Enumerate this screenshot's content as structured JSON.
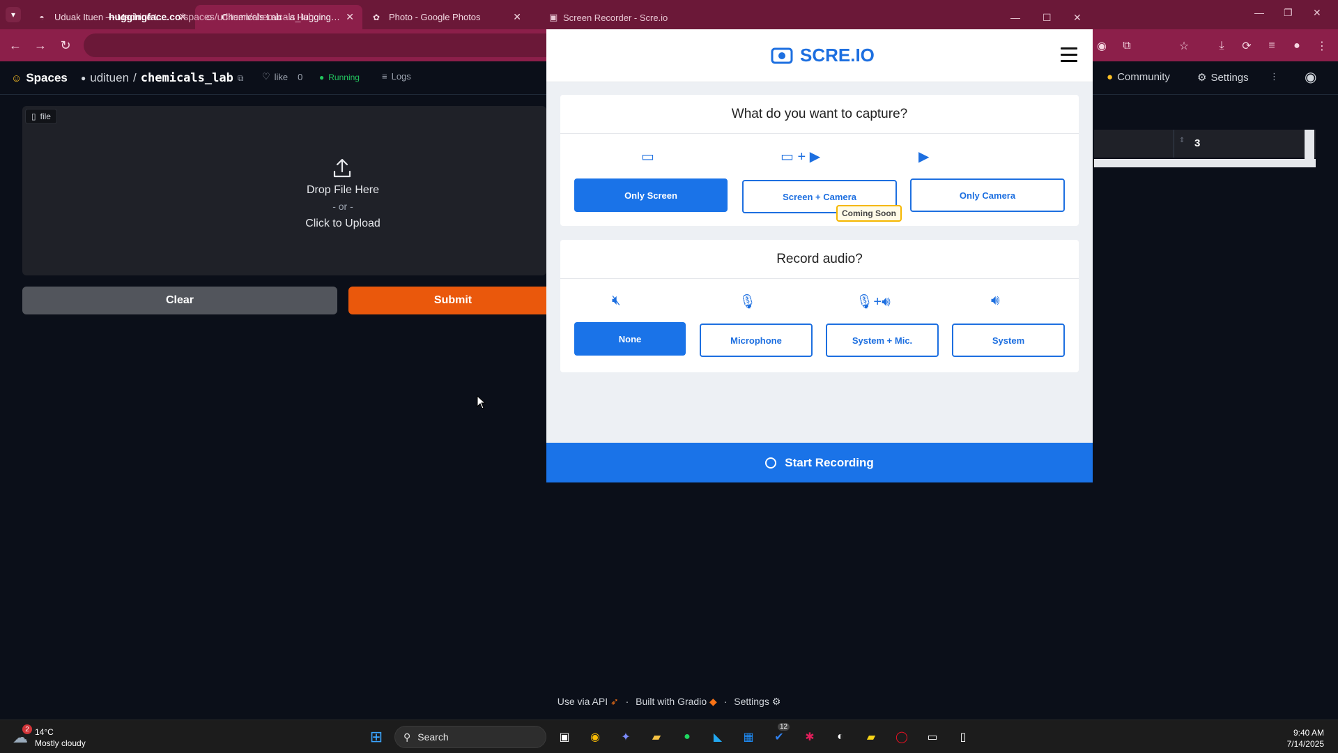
{
  "browser": {
    "tabs": [
      {
        "title": "Uduak Ituen — Machine Learni",
        "icon": "profile-favicon"
      },
      {
        "title": "Chemicals Lab - a Hugging Fac",
        "icon": "huggingface-favicon",
        "active": true
      },
      {
        "title": "Photo - Google Photos",
        "icon": "google-photos-favicon"
      }
    ],
    "url_domain": "huggingface.co",
    "url_path": "/spaces/udituen/chemicals_lab"
  },
  "hf_header": {
    "spaces_label": "Spaces",
    "owner": "udituen",
    "repo": "chemicals_lab",
    "like_label": "like",
    "like_count": "0",
    "status": "Running",
    "logs_label": "Logs",
    "community_label": "Community",
    "settings_label": "Settings"
  },
  "app": {
    "file_label": "file",
    "drop_line1": "Drop File Here",
    "drop_line2": "- or -",
    "drop_line3": "Click to Upload",
    "clear_label": "Clear",
    "submit_label": "Submit",
    "number_value": "3",
    "footer": {
      "api": "Use via API",
      "built": "Built with Gradio",
      "settings": "Settings",
      "sep": "·"
    }
  },
  "recorder": {
    "window_title": "Screen Recorder - Scre.io",
    "logo_text": "SCRE.IO",
    "capture_question": "What do you want to capture?",
    "capture_options": [
      {
        "label": "Only Screen",
        "selected": true,
        "icon": "monitor-icon"
      },
      {
        "label": "Screen + Camera",
        "selected": false,
        "icon": "monitor-camera-icon"
      },
      {
        "label": "Only Camera",
        "selected": false,
        "icon": "camera-icon"
      }
    ],
    "coming_soon": "Coming Soon",
    "audio_question": "Record audio?",
    "audio_options": [
      {
        "label": "None",
        "selected": true,
        "icon": "mute-icon"
      },
      {
        "label": "Microphone",
        "selected": false,
        "icon": "microphone-icon"
      },
      {
        "label": "System + Mic.",
        "selected": false,
        "icon": "mic-speaker-icon"
      },
      {
        "label": "System",
        "selected": false,
        "icon": "speaker-icon"
      }
    ],
    "start_label": "Start Recording"
  },
  "taskbar": {
    "weather_badge": "2",
    "temperature": "14°C",
    "weather": "Mostly cloudy",
    "search_label": "Search",
    "notif_badge": "12",
    "time": "9:40 AM",
    "date": "7/14/2025"
  },
  "colors": {
    "accent_blue": "#1a73e8",
    "submit_orange": "#ea580c",
    "browser_frame": "#8c1f4a",
    "coming_soon_border": "#f5b700",
    "running_green": "#22c55e"
  }
}
